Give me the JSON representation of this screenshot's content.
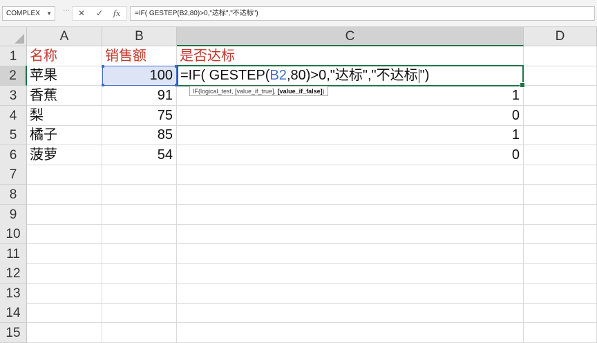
{
  "formula_bar": {
    "name_box": "COMPLEX",
    "cancel_icon": "✕",
    "enter_icon": "✓",
    "fx_icon": "fx",
    "content": "=IF( GESTEP(B2,80)>0,\"达标\",\"不达标\")"
  },
  "columns": [
    "A",
    "B",
    "C",
    "D"
  ],
  "rows": [
    "1",
    "2",
    "3",
    "4",
    "5",
    "6",
    "7",
    "8",
    "9",
    "10",
    "11",
    "12",
    "13",
    "14",
    "15"
  ],
  "header_row": {
    "a": "名称",
    "b": "销售额",
    "c": "是否达标"
  },
  "data_rows": [
    {
      "a": "苹果",
      "b": "100",
      "c": ""
    },
    {
      "a": "香蕉",
      "b": "91",
      "c": "1"
    },
    {
      "a": "梨",
      "b": "75",
      "c": "0"
    },
    {
      "a": "橘子",
      "b": "85",
      "c": "1"
    },
    {
      "a": "菠萝",
      "b": "54",
      "c": "0"
    }
  ],
  "editing_formula": {
    "p1": "=IF( GESTEP(",
    "ref": "B2",
    "p2": ",80)>0,\"达标\",\"不达标",
    "p3": "\")"
  },
  "tooltip": {
    "func": "IF(logical_test, [value_if_true], ",
    "bold": "[value_if_false]",
    "end": ")"
  },
  "colors": {
    "header_red": "#c0392b",
    "ref_blue": "#3f6dc7",
    "excel_green": "#217346"
  }
}
